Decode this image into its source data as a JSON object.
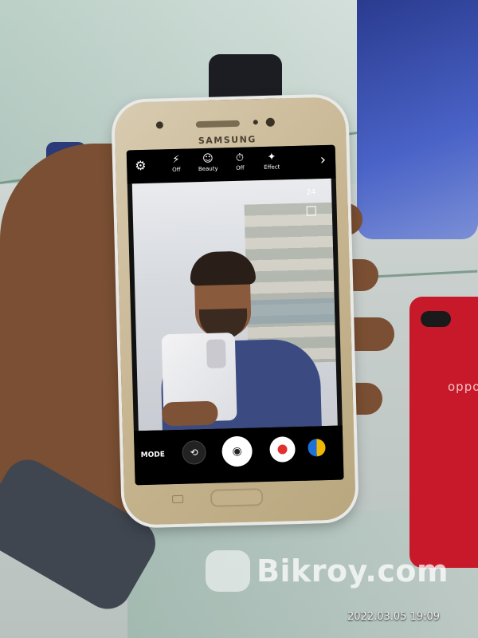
{
  "phone": {
    "brand": "SAMSUNG",
    "toolbar": {
      "items": [
        {
          "icon": "flash-off-icon",
          "label": "Off"
        },
        {
          "icon": "beauty-icon",
          "label": "Beauty"
        },
        {
          "icon": "timer-icon",
          "label": "Off"
        },
        {
          "icon": "effect-icon",
          "label": "Effect"
        }
      ]
    },
    "preview": {
      "counter": "24"
    },
    "bottom_bar": {
      "mode_label": "MODE"
    }
  },
  "background": {
    "oppo_logo": "oppo"
  },
  "watermark": {
    "text": "Bikroy.com"
  },
  "timestamp": "2022.03.05 19:09",
  "colors": {
    "phone_body": "#c7b591",
    "record_red": "#e23030",
    "oppo_red": "#c8192a"
  }
}
